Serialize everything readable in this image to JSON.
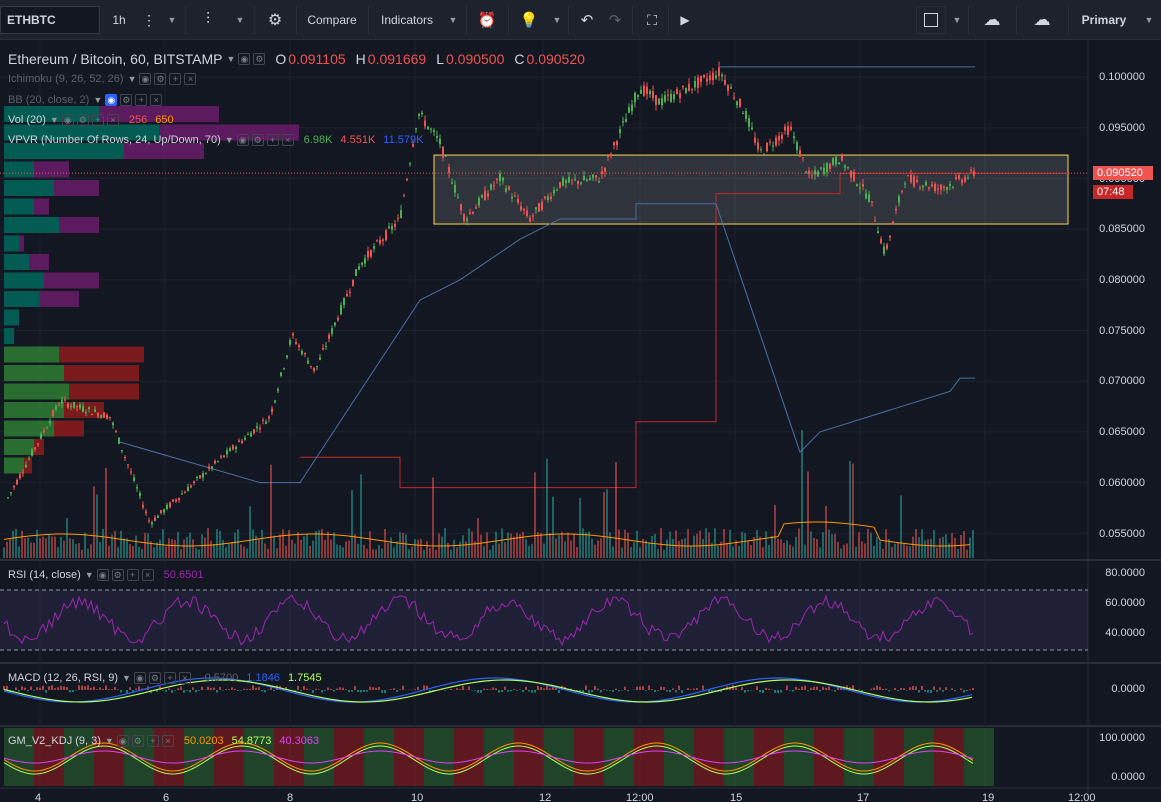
{
  "toolbar": {
    "symbol": "ETHBTC",
    "interval": "1h",
    "compare": "Compare",
    "indicators": "Indicators",
    "layout": "Primary"
  },
  "main_pane": {
    "title": "Ethereum / Bitcoin, 60, BITSTAMP",
    "ohlc": {
      "o_label": "O",
      "o": "0.091105",
      "h_label": "H",
      "h": "0.091669",
      "l_label": "L",
      "l": "0.090500",
      "c_label": "C",
      "c": "0.090520"
    },
    "indicators": {
      "ichimoku": "Ichimoku (9, 26, 52, 26)",
      "bb": "BB (20, close, 2)",
      "vol": {
        "name": "Vol (20)",
        "v1": "256",
        "v2": "650"
      },
      "vpvr": {
        "name": "VPVR (Number Of Rows, 24, Up/Down, 70)",
        "v1": "6.98K",
        "v2": "4.551K",
        "v3": "11.579K"
      }
    },
    "price_axis": [
      "0.100000",
      "0.095000",
      "0.090000",
      "0.085000",
      "0.080000",
      "0.075000",
      "0.070000",
      "0.065000",
      "0.060000",
      "0.055000"
    ],
    "last_price": "0.090520",
    "countdown": "07:48"
  },
  "rsi_pane": {
    "name": "RSI (14, close)",
    "value": "50.6501",
    "axis": [
      "80.0000",
      "60.0000",
      "40.0000"
    ]
  },
  "macd_pane": {
    "name": "MACD (12, 26, RSI, 9)",
    "v1": "-0.5700",
    "v2": "1.1846",
    "v3": "1.7545",
    "axis": [
      "0.0000"
    ]
  },
  "kdj_pane": {
    "name": "GM_V2_KDJ (9, 3)",
    "v1": "50.0203",
    "v2": "54.8773",
    "v3": "40.3063",
    "axis": [
      "100.0000",
      "0.0000"
    ]
  },
  "time_axis": [
    "4",
    "6",
    "8",
    "10",
    "12",
    "12:00",
    "15",
    "17",
    "19",
    "12:00"
  ],
  "colors": {
    "bg": "#131722",
    "up": "#26a69a",
    "down": "#ef5350",
    "green": "#4caf50",
    "red": "#e53935",
    "purple": "#9c27b0",
    "blue": "#2962ff",
    "yellow": "#ffeb3b",
    "orange": "#ff9800"
  }
}
